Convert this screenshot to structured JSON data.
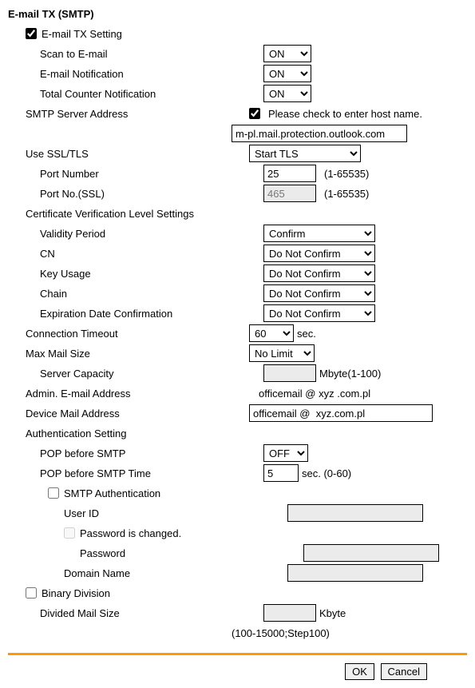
{
  "title": "E-mail TX (SMTP)",
  "emailTxSetting": {
    "label": "E-mail TX Setting",
    "checked": true
  },
  "scanToEmail": {
    "label": "Scan to E-mail",
    "value": "ON"
  },
  "emailNotification": {
    "label": "E-mail Notification",
    "value": "ON"
  },
  "totalCounterNotification": {
    "label": "Total Counter Notification",
    "value": "ON"
  },
  "smtpServerAddress": {
    "label": "SMTP Server Address",
    "checkLabel": "Please check to enter host name.",
    "checked": true,
    "value": "m-pl.mail.protection.outlook.com"
  },
  "useSSLTLS": {
    "label": "Use SSL/TLS",
    "value": "Start TLS"
  },
  "portNumber": {
    "label": "Port Number",
    "value": "25",
    "hint": "(1-65535)"
  },
  "portNumberSSL": {
    "label": "Port No.(SSL)",
    "value": "465",
    "hint": "(1-65535)"
  },
  "certLevel": {
    "title": "Certificate Verification Level Settings",
    "validityPeriod": {
      "label": "Validity Period",
      "value": "Confirm"
    },
    "cn": {
      "label": "CN",
      "value": "Do Not Confirm"
    },
    "keyUsage": {
      "label": "Key Usage",
      "value": "Do Not Confirm"
    },
    "chain": {
      "label": "Chain",
      "value": "Do Not Confirm"
    },
    "expiration": {
      "label": "Expiration Date Confirmation",
      "value": "Do Not Confirm"
    }
  },
  "connectionTimeout": {
    "label": "Connection Timeout",
    "value": "60",
    "unit": "sec."
  },
  "maxMailSize": {
    "label": "Max Mail Size",
    "value": "No Limit"
  },
  "serverCapacity": {
    "label": "Server Capacity",
    "value": "",
    "unit": "Mbyte(1-100)"
  },
  "adminEmail": {
    "label": "Admin. E-mail Address",
    "value": "officemail @  xyz .com.pl"
  },
  "deviceMail": {
    "label": "Device Mail Address",
    "value": "officemail @  xyz.com.pl"
  },
  "authSetting": {
    "title": "Authentication Setting",
    "popBeforeSmtp": {
      "label": "POP before SMTP",
      "value": "OFF"
    },
    "popBeforeSmtpTime": {
      "label": "POP before SMTP Time",
      "value": "5",
      "unit": "sec. (0-60)"
    },
    "smtpAuth": {
      "label": "SMTP Authentication",
      "checked": false
    },
    "userId": {
      "label": "User ID",
      "value": ""
    },
    "passwordChanged": {
      "label": "Password is changed.",
      "checked": false
    },
    "password": {
      "label": "Password",
      "value": ""
    },
    "domainName": {
      "label": "Domain Name",
      "value": ""
    }
  },
  "binaryDivision": {
    "label": "Binary Division",
    "checked": false
  },
  "dividedMailSize": {
    "label": "Divided Mail Size",
    "value": "",
    "unit": "Kbyte",
    "hint": "(100-15000;Step100)"
  },
  "buttons": {
    "ok": "OK",
    "cancel": "Cancel"
  }
}
